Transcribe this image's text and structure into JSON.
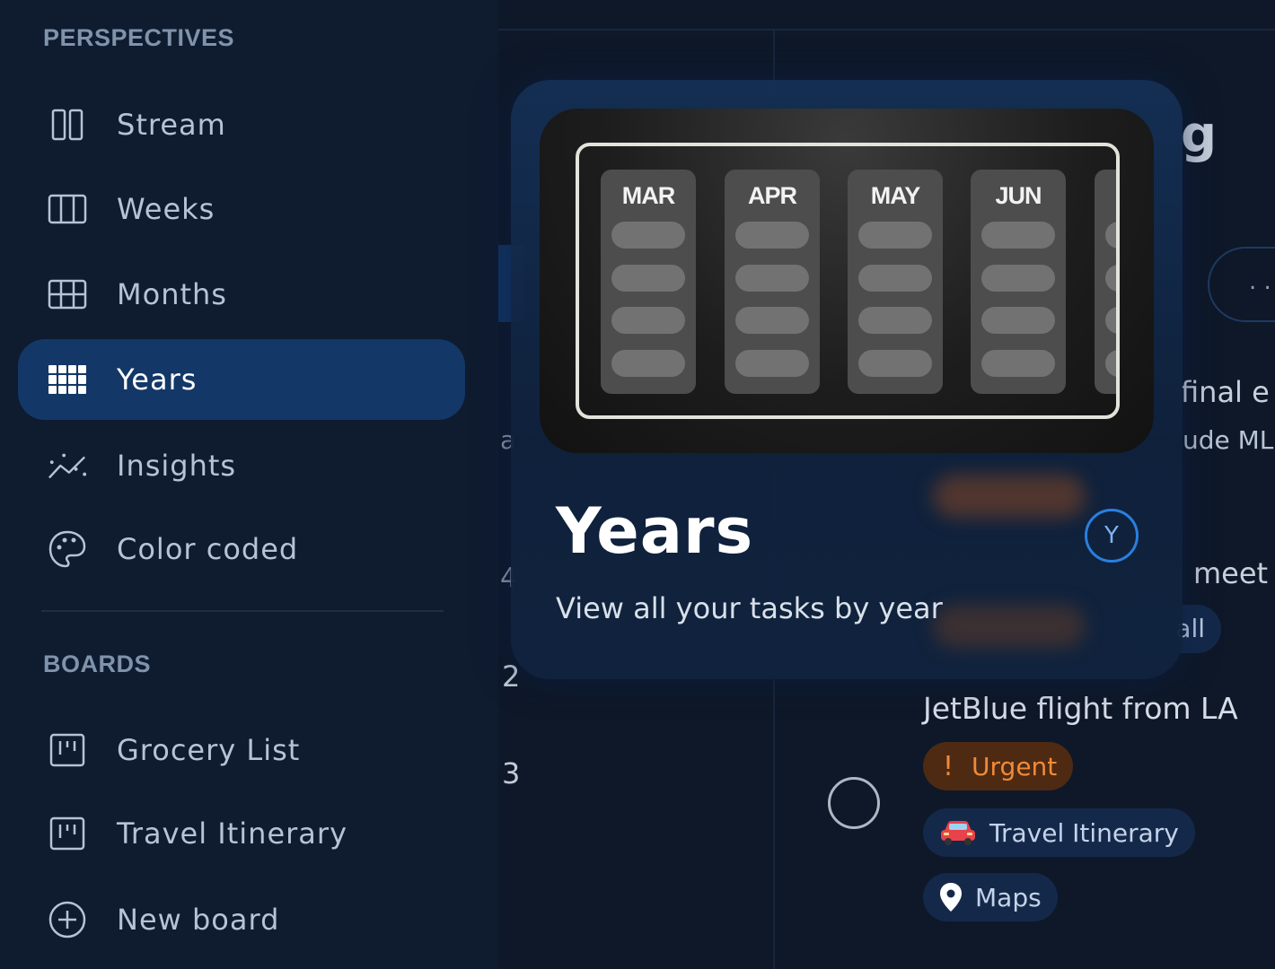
{
  "sidebar": {
    "perspectives_heading": "PERSPECTIVES",
    "perspectives": [
      {
        "label": "Stream",
        "icon": "stream-icon"
      },
      {
        "label": "Weeks",
        "icon": "weeks-icon"
      },
      {
        "label": "Months",
        "icon": "months-icon"
      },
      {
        "label": "Years",
        "icon": "years-icon",
        "active": true
      },
      {
        "label": "Insights",
        "icon": "insights-icon"
      },
      {
        "label": "Color coded",
        "icon": "palette-icon"
      }
    ],
    "boards_heading": "BOARDS",
    "boards": [
      {
        "label": "Grocery List",
        "icon": "board-icon"
      },
      {
        "label": "Travel Itinerary",
        "icon": "board-icon"
      }
    ],
    "new_board_label": "New board"
  },
  "tooltip": {
    "title": "Years",
    "shortcut": "Y",
    "description": "View all your tasks by year",
    "preview_months": [
      "MAR",
      "APR",
      "MAY",
      "JUN"
    ]
  },
  "main": {
    "title_fragment": "g",
    "pill_fragment": ". .",
    "left_fragment_a": "a",
    "left_fragment_4": "4",
    "row_numbers": [
      "2",
      "3"
    ],
    "frag_final": "final e",
    "frag_ml": "ude ML",
    "frag_meet": "meet",
    "frag_all": "all",
    "task": {
      "title": "JetBlue flight from LA",
      "tags": {
        "urgent_icon": "!",
        "urgent": "Urgent",
        "travel": "Travel Itinerary",
        "maps": "Maps"
      }
    }
  },
  "colors": {
    "sidebar_bg": "#0f1b2f",
    "active_item_bg": "#133766",
    "urgent_bg": "#4e2a12",
    "urgent_text": "#f08a3a",
    "shortcut_ring": "#2a7fe0"
  }
}
